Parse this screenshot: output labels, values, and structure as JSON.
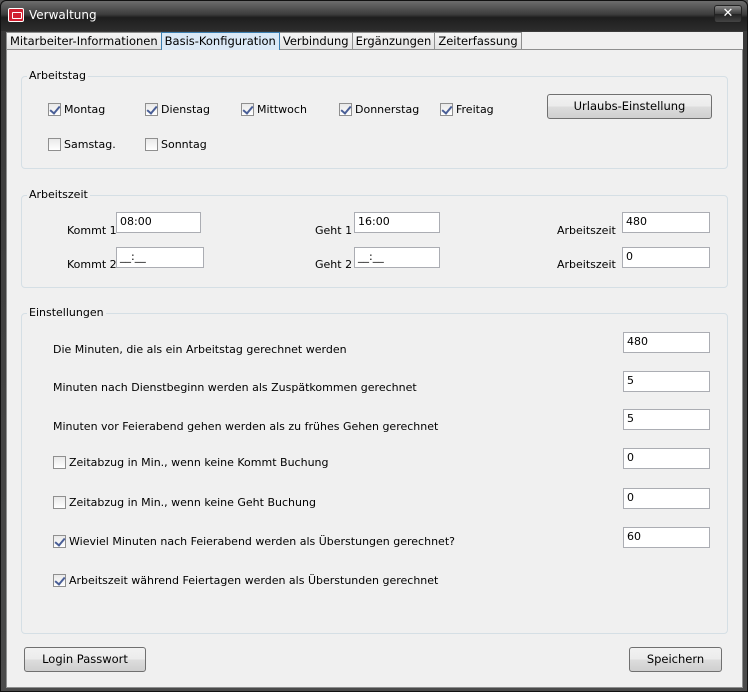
{
  "window": {
    "title": "Verwaltung",
    "close_glyph": "✕"
  },
  "tabs": [
    {
      "label": "Mitarbeiter-Informationen"
    },
    {
      "label": "Basis-Konfiguration"
    },
    {
      "label": "Verbindung"
    },
    {
      "label": "Ergänzungen"
    },
    {
      "label": "Zeiterfassung"
    }
  ],
  "arbeitstag": {
    "title": "Arbeitstag",
    "days": [
      {
        "label": "Montag",
        "checked": true
      },
      {
        "label": "Dienstag",
        "checked": true
      },
      {
        "label": "Mittwoch",
        "checked": true
      },
      {
        "label": "Donnerstag",
        "checked": true
      },
      {
        "label": "Freitag",
        "checked": true
      },
      {
        "label": "Samstag.",
        "checked": false
      },
      {
        "label": "Sonntag",
        "checked": false
      }
    ],
    "urlaub_button": "Urlaubs-Einstellung"
  },
  "arbeitszeit": {
    "title": "Arbeitszeit",
    "kommt1_label": "Kommt 1",
    "kommt1_value": "08:00",
    "geht1_label": "Geht 1",
    "geht1_value": "16:00",
    "arbeitszeit1_label": "Arbeitszeit",
    "arbeitszeit1_value": "480",
    "kommt2_label": "Kommt 2",
    "kommt2_value": "__:__",
    "geht2_label": "Geht 2",
    "geht2_value": "__:__",
    "arbeitszeit2_label": "Arbeitszeit",
    "arbeitszeit2_value": "0"
  },
  "einstellungen": {
    "title": "Einstellungen",
    "rows": [
      {
        "label": "Die Minuten, die als ein Arbeitstag gerechnet werden",
        "value": "480"
      },
      {
        "label": "Minuten nach Dienstbeginn werden als Zuspätkommen gerechnet",
        "value": "5"
      },
      {
        "label": "Minuten vor Feierabend gehen werden als zu frühes Gehen gerechnet",
        "value": "5"
      },
      {
        "label": "Zeitabzug in Min., wenn keine Kommt Buchung",
        "value": "0",
        "checked": false
      },
      {
        "label": "Zeitabzug in Min., wenn keine Geht Buchung",
        "value": "0",
        "checked": false
      },
      {
        "label": "Wieviel Minuten nach Feierabend werden als Überstungen gerechnet?",
        "value": "60",
        "checked": true
      },
      {
        "label": "Arbeitszeit während Feiertagen werden als Überstunden gerechnet",
        "checked": true
      }
    ]
  },
  "footer": {
    "login_button": "Login Passwort",
    "save_button": "Speichern"
  }
}
